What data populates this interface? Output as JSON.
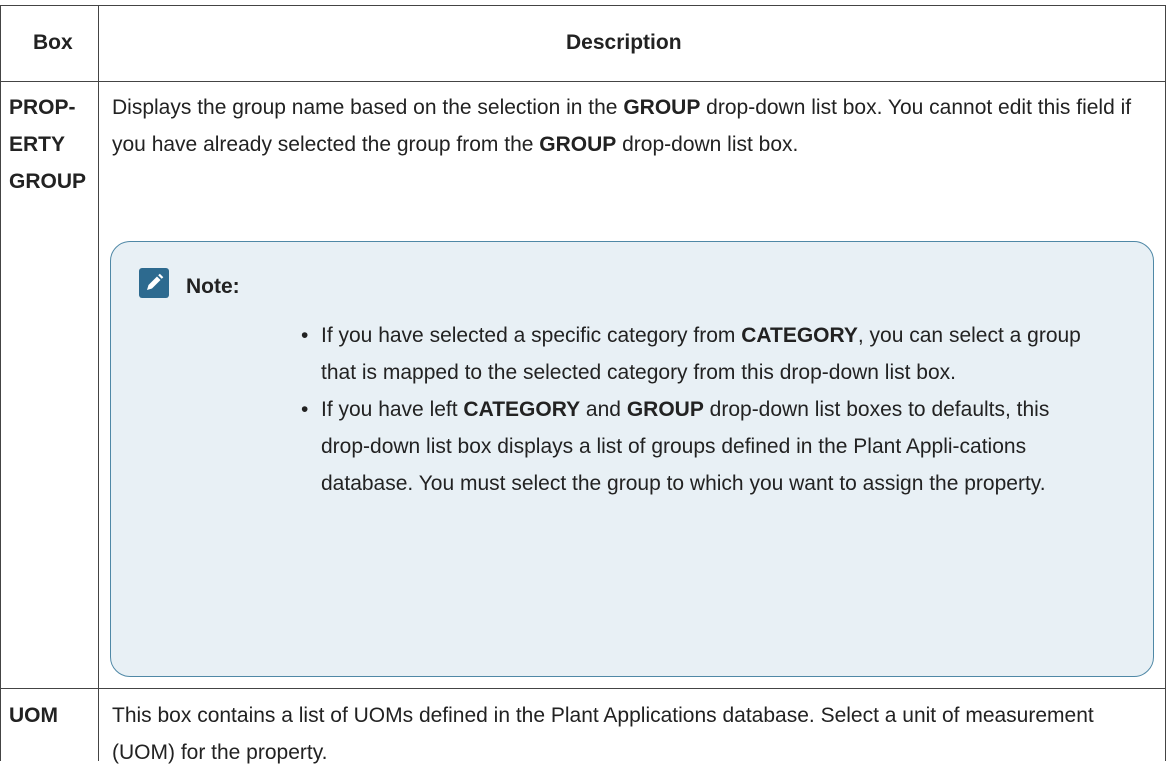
{
  "table": {
    "headers": {
      "box": "Box",
      "description": "Description"
    },
    "rows": [
      {
        "box": "PROP-\nERTY\nGROUP",
        "description": {
          "p1": "Displays the group name based on the selection in the ",
          "b1": "GROUP",
          "p2": " drop-down list box. You cannot edit this field if you have already selected the group from the ",
          "b2": "GROUP",
          "p3": " drop-down list box."
        },
        "note": {
          "title": "Note:",
          "icon": "pencil-edit-icon",
          "items": [
            {
              "p1": "If you have selected a specific category from ",
              "b1": "CATEGORY",
              "p2": ", you can select a group that is mapped to the selected category from this drop-down list box."
            },
            {
              "p1": "If you have left ",
              "b1": "CATEGORY",
              "p2": " and ",
              "b2": "GROUP",
              "p3": " drop-down list boxes to defaults, this drop-down list box displays a list of groups defined in the Plant Appli-cations database. You must select the group to which you want to assign the property."
            }
          ]
        }
      },
      {
        "box": "UOM",
        "description": {
          "p1": "This box contains a list of UOMs defined in the Plant Applications database. Select a unit of measurement (UOM) for the property."
        }
      }
    ]
  },
  "colors": {
    "border": "#444444",
    "note_background": "#e8f0f5",
    "note_border": "#4f88a6",
    "note_icon": "#2d6a8f"
  }
}
